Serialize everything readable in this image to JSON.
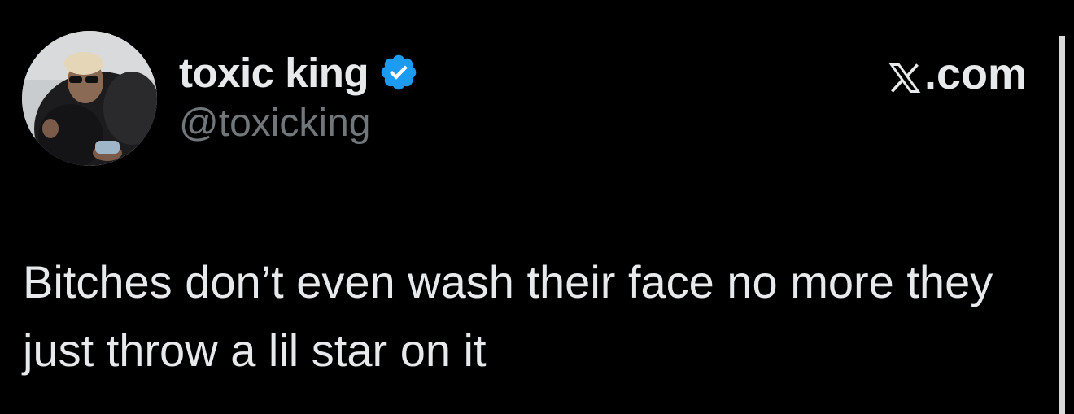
{
  "author": {
    "display_name": "toxic king",
    "handle": "@toxicking",
    "verified": true,
    "verified_color": "#1d9bf0",
    "avatar_icon": "profile-photo"
  },
  "source": {
    "label": ".com",
    "logo_icon": "x-logo-icon"
  },
  "tweet": {
    "text": "Bitches don’t even wash their face no more they just throw a lil star on it"
  },
  "colors": {
    "background": "#000000",
    "primary_text": "#e7e9ea",
    "secondary_text": "#71767b"
  }
}
